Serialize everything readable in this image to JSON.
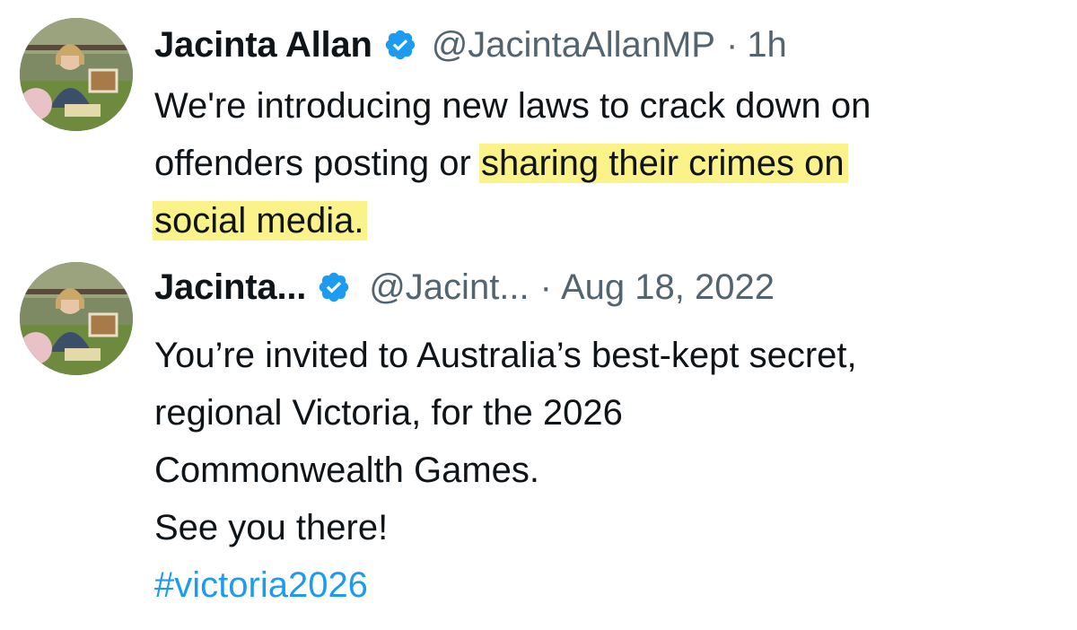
{
  "colors": {
    "verified_badge": "#1d9bf0",
    "hashtag": "#1d9bf0",
    "highlight": "#fbf28a",
    "secondary_text": "#536471"
  },
  "tweets": [
    {
      "author_name": "Jacinta Allan",
      "verified_icon": "verified-badge-icon",
      "handle": "@JacintaAllanMP",
      "separator": "·",
      "time": "1h",
      "text": {
        "line1": "We're introducing new laws to crack down on",
        "line2_plain": "offenders posting or ",
        "line2_highlight": "sharing their crimes on",
        "line3_highlight": "social media."
      }
    },
    {
      "author_name": "Jacinta...",
      "verified_icon": "verified-badge-icon",
      "handle": "@Jacint...",
      "separator": "·",
      "time": "Aug 18, 2022",
      "text": {
        "line1": "You’re invited to Australia’s best-kept secret,",
        "line2": "regional Victoria, for the 2026",
        "line3": "Commonwealth Games.",
        "line4": "See you there!",
        "hashtag": "#victoria2026"
      }
    }
  ]
}
